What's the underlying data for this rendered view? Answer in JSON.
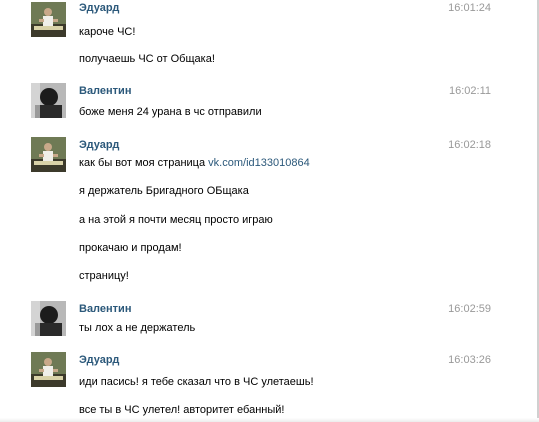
{
  "messages": [
    {
      "author": "Эдуард",
      "time": "16:01:24",
      "avatar": "eduard-avatar",
      "lines": [
        "кароче ЧС!",
        "получаешь ЧС от Общака!"
      ]
    },
    {
      "author": "Валентин",
      "time": "16:02:11",
      "avatar": "valentin-avatar",
      "lines": [
        "боже меня 24 урана в чс отправили"
      ]
    },
    {
      "author": "Эдуард",
      "time": "16:02:18",
      "avatar": "eduard-avatar",
      "lines": [
        "как бы вот моя страница",
        "я держатель Бригадного ОБщака",
        "а на этой я почти месяц просто играю",
        "прокачаю и продам!",
        "страницу!"
      ],
      "link": "vk.com/id133010864"
    },
    {
      "author": "Валентин",
      "time": "16:02:59",
      "avatar": "valentin-avatar",
      "lines": [
        "ты лох а не держатель"
      ]
    },
    {
      "author": "Эдуард",
      "time": "16:03:26",
      "avatar": "eduard-avatar",
      "lines": [
        "иди пасись! я тебе сказал что в ЧС улетаешь!",
        "все ты в ЧС улетел! авторитет ебанный!"
      ]
    }
  ],
  "colors": {
    "author": "#2b587a",
    "time": "#999999",
    "text": "#000000",
    "link": "#2b587a"
  }
}
